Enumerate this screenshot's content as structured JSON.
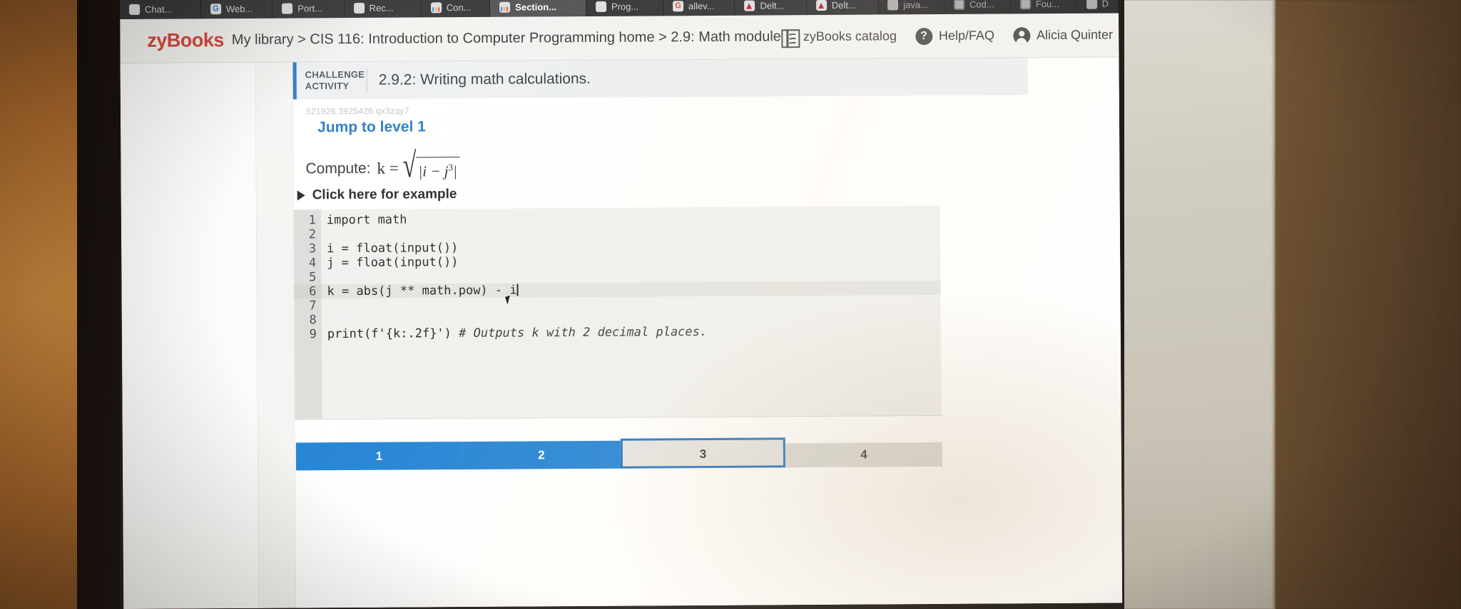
{
  "browser": {
    "tabs": [
      {
        "label": "Chat...",
        "icon": "chat-icon",
        "active": false
      },
      {
        "label": "Web...",
        "icon": "grammarly-icon",
        "active": false
      },
      {
        "label": "Port...",
        "icon": "portal-icon",
        "active": false
      },
      {
        "label": "Rec...",
        "icon": "figma-icon",
        "active": false
      },
      {
        "label": "Con...",
        "icon": "zybooks-icon",
        "active": false
      },
      {
        "label": "Section...",
        "icon": "zybooks-icon",
        "active": true
      },
      {
        "label": "Prog...",
        "icon": "program-icon",
        "active": false
      },
      {
        "label": "allev...",
        "icon": "google-icon",
        "active": false
      },
      {
        "label": "Delt...",
        "icon": "delta-icon",
        "active": false
      },
      {
        "label": "Delt...",
        "icon": "delta-icon",
        "active": false
      },
      {
        "label": "java...",
        "icon": "java-icon",
        "active": false
      },
      {
        "label": "Cod...",
        "icon": "circle-icon",
        "active": false
      },
      {
        "label": "Fou...",
        "icon": "circle-icon",
        "active": false
      },
      {
        "label": "D...",
        "icon": "shield-icon",
        "active": false
      }
    ]
  },
  "header": {
    "logo": "zyBooks",
    "breadcrumb": "My library > CIS 116: Introduction to Computer Programming home > 2.9: Math module",
    "catalog_label": "zyBooks catalog",
    "help_label": "Help/FAQ",
    "help_glyph": "?",
    "user_name": "Alicia Quinter",
    "accent_red": "#cf3a2c",
    "accent_blue": "#1b6fc4"
  },
  "activity": {
    "tag_line1": "CHALLENGE",
    "tag_line2": "ACTIVITY",
    "title": "2.9.2: Writing math calculations.",
    "id": "521926.3925426.qx3zqy7",
    "jump_link": "Jump to level 1",
    "compute_label": "Compute:",
    "formula_var": "k =",
    "formula_radicand": "|i − j",
    "formula_exponent": "3",
    "formula_close": "|",
    "example_toggle": "Click here for example"
  },
  "editor": {
    "lines": [
      {
        "n": "1",
        "text": "import math",
        "highlight": false
      },
      {
        "n": "2",
        "text": "",
        "highlight": false
      },
      {
        "n": "3",
        "text": "i = float(input())",
        "highlight": false
      },
      {
        "n": "4",
        "text": "j = float(input())",
        "highlight": false
      },
      {
        "n": "5",
        "text": "",
        "highlight": false
      },
      {
        "n": "6",
        "text": "k = abs(j ** math.pow) - i",
        "highlight": true
      },
      {
        "n": "7",
        "text": "",
        "highlight": false
      },
      {
        "n": "8",
        "text": "",
        "highlight": false
      },
      {
        "n": "9",
        "text": "print(f'{k:.2f}') # Outputs k with 2 decimal places.",
        "highlight": false
      }
    ],
    "line9_code": "print(f'{k:.2f}') ",
    "line9_comment": "# Outputs k with 2 decimal places."
  },
  "levels": [
    {
      "label": "1",
      "state": "complete"
    },
    {
      "label": "2",
      "state": "complete"
    },
    {
      "label": "3",
      "state": "current"
    },
    {
      "label": "4",
      "state": "locked"
    }
  ],
  "progress_rail": [
    {
      "num": "1",
      "state": "checked"
    },
    {
      "num": "2",
      "state": "checked"
    },
    {
      "num": "3",
      "state": "empty"
    },
    {
      "num": "4",
      "state": "empty"
    }
  ]
}
